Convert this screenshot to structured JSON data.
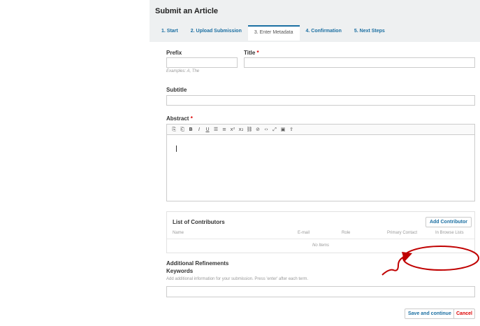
{
  "header": {
    "title": "Submit an Article"
  },
  "tabs": [
    {
      "label": "1. Start"
    },
    {
      "label": "2. Upload Submission"
    },
    {
      "label": "3. Enter Metadata"
    },
    {
      "label": "4. Confirmation"
    },
    {
      "label": "5. Next Steps"
    }
  ],
  "active_tab_index": 2,
  "form": {
    "prefix_label": "Prefix",
    "prefix_value": "",
    "prefix_hint": "Examples: A, The",
    "title_label": "Title",
    "title_value": "",
    "required_mark": "*",
    "subtitle_label": "Subtitle",
    "subtitle_value": "",
    "abstract_label": "Abstract"
  },
  "editor_toolbar": [
    {
      "icon": "copy-icon",
      "glyph": "⎘"
    },
    {
      "icon": "paste-icon",
      "glyph": "⎗"
    },
    {
      "icon": "bold-icon",
      "glyph": "B"
    },
    {
      "icon": "italic-icon",
      "glyph": "I"
    },
    {
      "icon": "underline-icon",
      "glyph": "U"
    },
    {
      "icon": "bullet-list-icon",
      "glyph": "☰"
    },
    {
      "icon": "numbered-list-icon",
      "glyph": "≡"
    },
    {
      "icon": "superscript-icon",
      "glyph": "x²"
    },
    {
      "icon": "subscript-icon",
      "glyph": "x₂"
    },
    {
      "icon": "link-icon",
      "glyph": "⛓"
    },
    {
      "icon": "unlink-icon",
      "glyph": "⊘"
    },
    {
      "icon": "code-icon",
      "glyph": "‹›"
    },
    {
      "icon": "fullscreen-icon",
      "glyph": "⤢"
    },
    {
      "icon": "image-icon",
      "glyph": "▣"
    },
    {
      "icon": "upload-icon",
      "glyph": "⇪"
    }
  ],
  "contributors": {
    "title": "List of Contributors",
    "add_button": "Add Contributor",
    "columns": [
      "Name",
      "E-mail",
      "Role",
      "Primary Contact",
      "In Browse Lists"
    ],
    "empty_text": "No Items"
  },
  "refinements": {
    "heading": "Additional Refinements",
    "keywords_label": "Keywords",
    "keywords_help": "Add additional information for your submission. Press 'enter' after each term.",
    "keywords_value": ""
  },
  "actions": {
    "save": "Save and continue",
    "cancel": "Cancel"
  },
  "colors": {
    "accent": "#1b6fa2",
    "required": "#dd0000",
    "annotation": "#c00000"
  }
}
